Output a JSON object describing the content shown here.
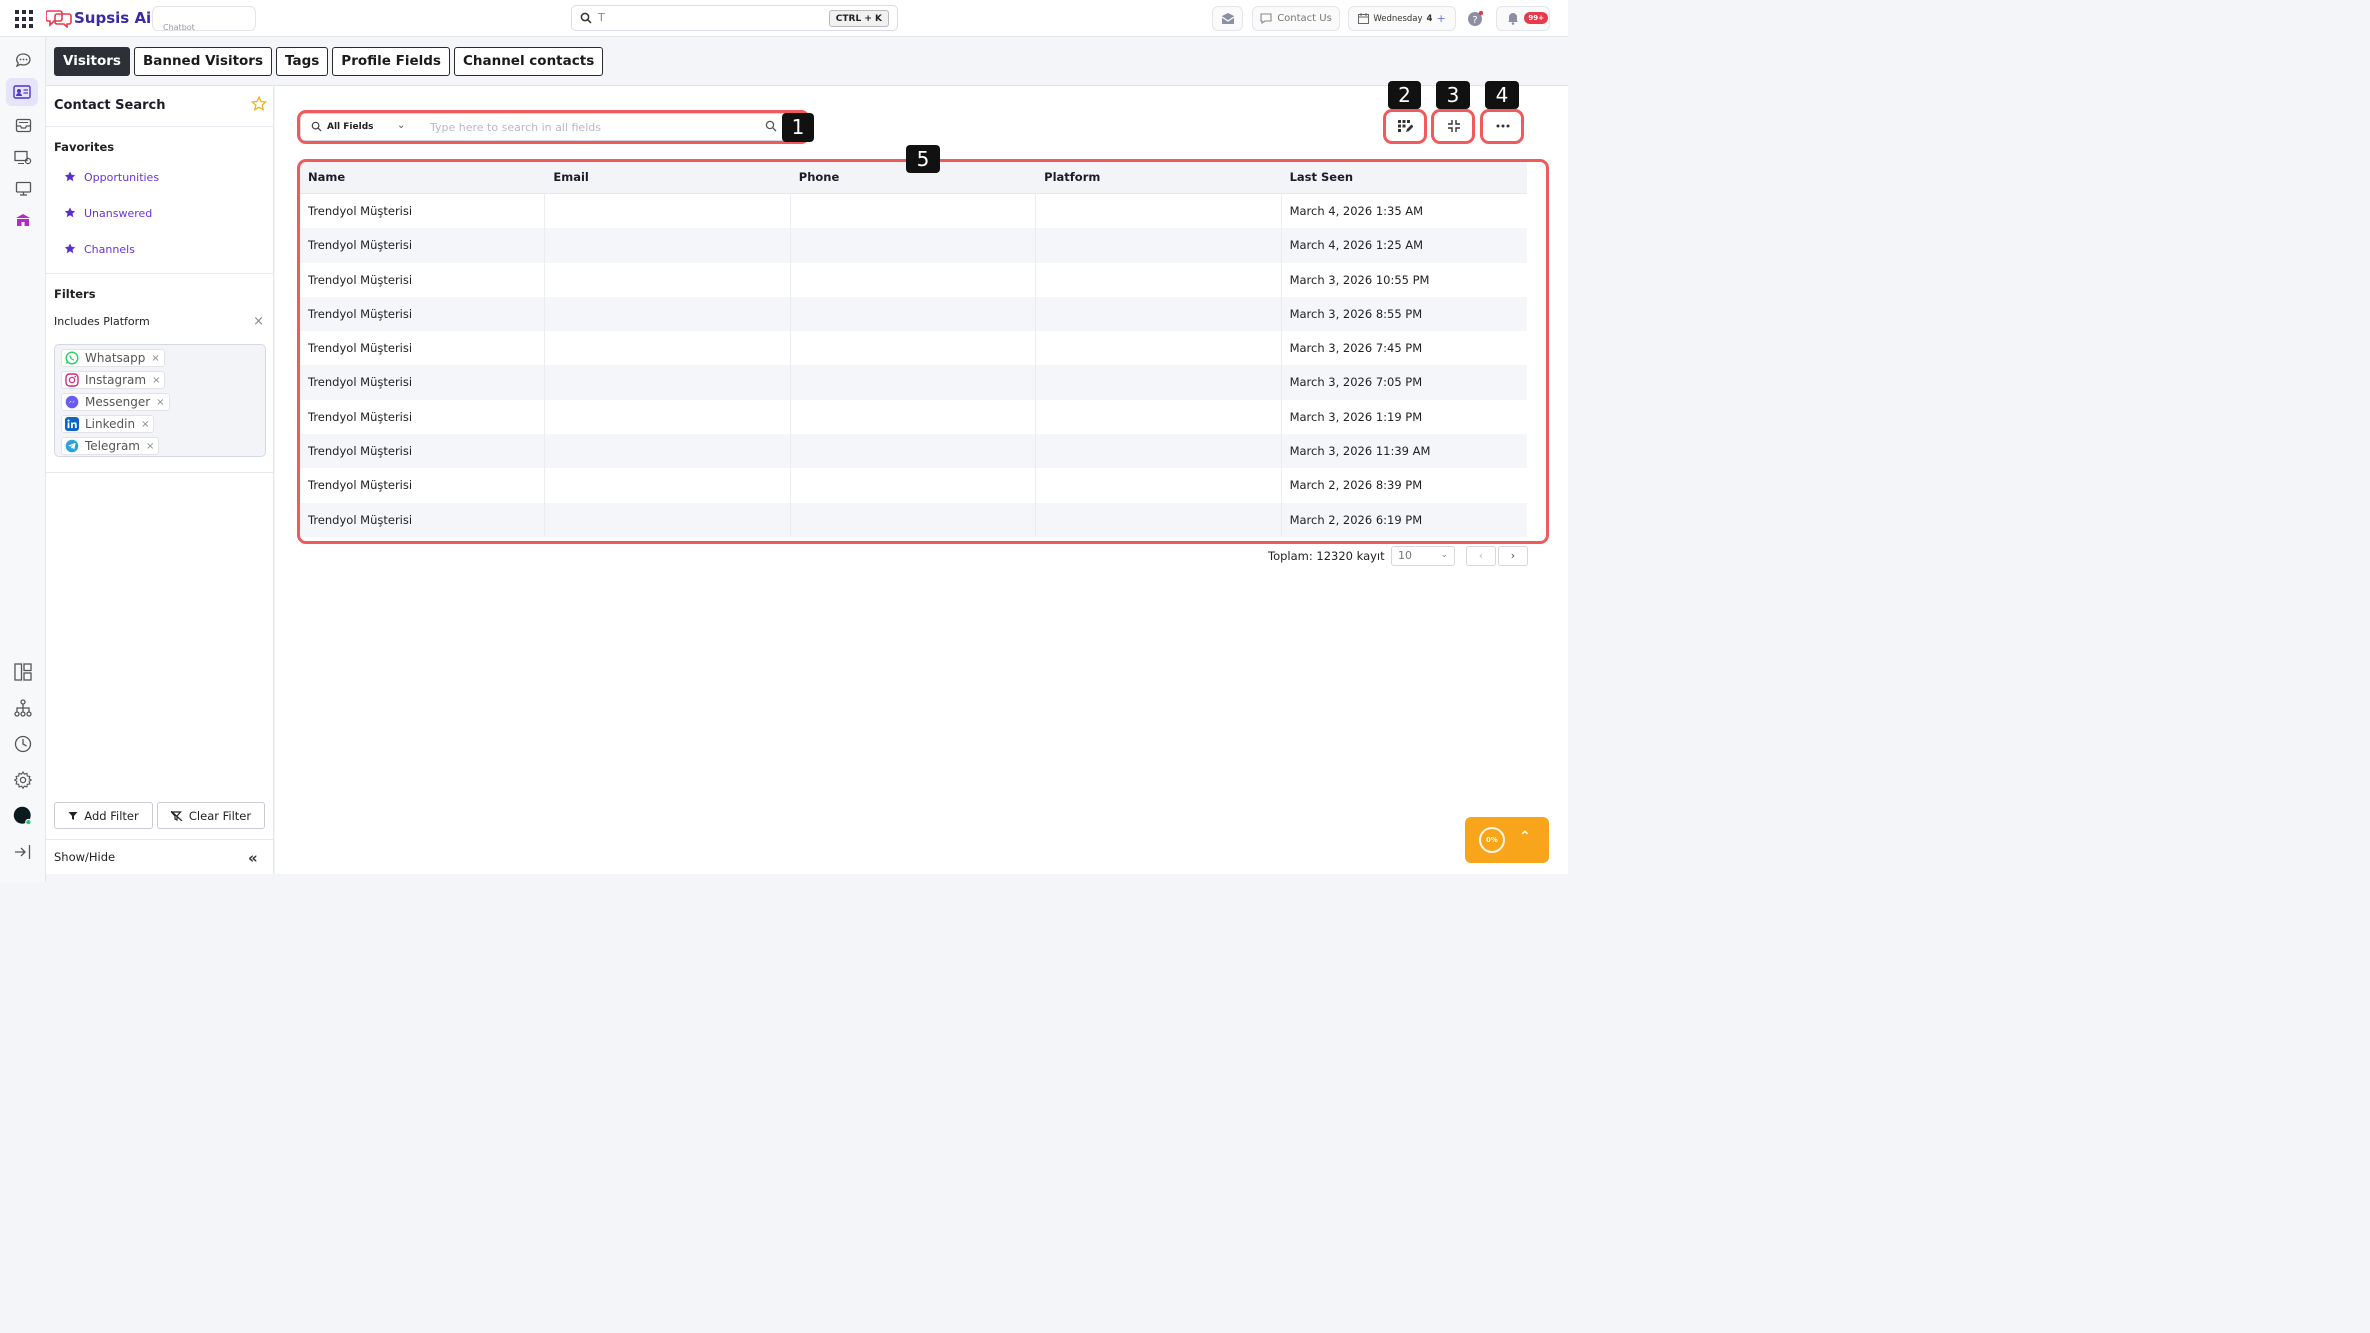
{
  "app": {
    "brand": "Supsis Ai",
    "workspace_hint": "Chatbot"
  },
  "topbar": {
    "search_query": "T",
    "shortcut": "CTRL + K",
    "contact_us": "Contact Us",
    "date_label": "Wednesday",
    "date_day": "4",
    "notifications": "99+"
  },
  "tabs": [
    "Visitors",
    "Banned Visitors",
    "Tags",
    "Profile Fields",
    "Channel contacts"
  ],
  "left_panel": {
    "title": "Contact Search",
    "favorites_heading": "Favorites",
    "favorites": [
      "Opportunities",
      "Unanswered",
      "Channels"
    ],
    "filters_heading": "Filters",
    "include_label": "Includes Platform",
    "platforms": [
      "Whatsapp",
      "Instagram",
      "Messenger",
      "Linkedin",
      "Telegram"
    ],
    "add_filter": "Add Filter",
    "clear_filter": "Clear Filter",
    "show_hide": "Show/Hide"
  },
  "search": {
    "field_select": "All Fields",
    "placeholder": "Type here to search in all fields"
  },
  "markers": [
    "1",
    "2",
    "3",
    "4",
    "5"
  ],
  "table": {
    "columns": [
      "Name",
      "Email",
      "Phone",
      "Platform",
      "Last Seen"
    ],
    "rows": [
      [
        "Trendyol Müşterisi",
        "",
        "",
        "",
        "March 4, 2026 1:35 AM"
      ],
      [
        "Trendyol Müşterisi",
        "",
        "",
        "",
        "March 4, 2026 1:25 AM"
      ],
      [
        "Trendyol Müşterisi",
        "",
        "",
        "",
        "March 3, 2026 10:55 PM"
      ],
      [
        "Trendyol Müşterisi",
        "",
        "",
        "",
        "March 3, 2026 8:55 PM"
      ],
      [
        "Trendyol Müşterisi",
        "",
        "",
        "",
        "March 3, 2026 7:45 PM"
      ],
      [
        "Trendyol Müşterisi",
        "",
        "",
        "",
        "March 3, 2026 7:05 PM"
      ],
      [
        "Trendyol Müşterisi",
        "",
        "",
        "",
        "March 3, 2026 1:19 PM"
      ],
      [
        "Trendyol Müşterisi",
        "",
        "",
        "",
        "March 3, 2026 11:39 AM"
      ],
      [
        "Trendyol Müşterisi",
        "",
        "",
        "",
        "March 2, 2026 8:39 PM"
      ],
      [
        "Trendyol Müşterisi",
        "",
        "",
        "",
        "March 2, 2026 6:19 PM"
      ]
    ]
  },
  "pagination": {
    "total": "Toplam: 12320 kayıt",
    "page_size": "10",
    "prev": "‹",
    "next": "›"
  },
  "progress_widget": {
    "label": "0%"
  },
  "colors": {
    "brand": "#3b2aa6",
    "accent_purple": "#6a34d6",
    "highlight_red": "#f05a5a",
    "progress_orange": "#f8a51c"
  }
}
